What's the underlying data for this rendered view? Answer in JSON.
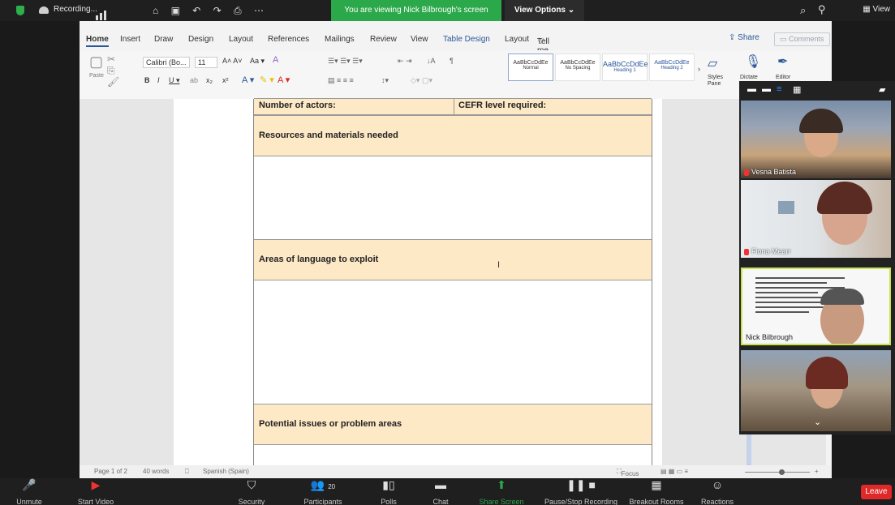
{
  "zoom_top": {
    "recording_label": "Recording...",
    "banner_text": "You are viewing Nick Bilbrough's screen",
    "view_options_label": "View Options ⌄",
    "view_label": "View"
  },
  "word": {
    "menu_tabs": [
      "Home",
      "Insert",
      "Draw",
      "Design",
      "Layout",
      "References",
      "Mailings",
      "Review",
      "View",
      "Table Design",
      "Layout",
      "Tell me"
    ],
    "share_label": "Share",
    "comments_label": "Comments",
    "font_name": "Calibri (Bo...",
    "font_size": "11",
    "styles": [
      "Normal",
      "No Spacing",
      "Heading 1",
      "Heading 2"
    ],
    "style_sample": "AaBbCcDdEe",
    "styles_pane": "Styles Pane",
    "dictate": "Dictate",
    "editor": "Editor",
    "paste": "Paste"
  },
  "document": {
    "row1_left": "Number of actors:",
    "row1_right": "CEFR level required:",
    "section1": "Resources and materials needed",
    "section2": "Areas of language to exploit",
    "section3": "Potential issues or problem areas"
  },
  "statusbar": {
    "page": "Page 1 of 2",
    "words": "40 words",
    "language": "Spanish (Spain)",
    "focus": "Focus"
  },
  "participants": [
    {
      "name": "Vesna Batista"
    },
    {
      "name": "Fiona Mearr"
    },
    {
      "name": "Nick Bilbrough"
    },
    {
      "name": ""
    }
  ],
  "zoom_bottom": {
    "unmute": "Unmute",
    "start_video": "Start Video",
    "security": "Security",
    "participants": "Participants",
    "participants_count": "20",
    "polls": "Polls",
    "chat": "Chat",
    "share_screen": "Share Screen",
    "pause_recording": "Pause/Stop Recording",
    "breakout_rooms": "Breakout Rooms",
    "reactions": "Reactions",
    "leave": "Leave"
  }
}
